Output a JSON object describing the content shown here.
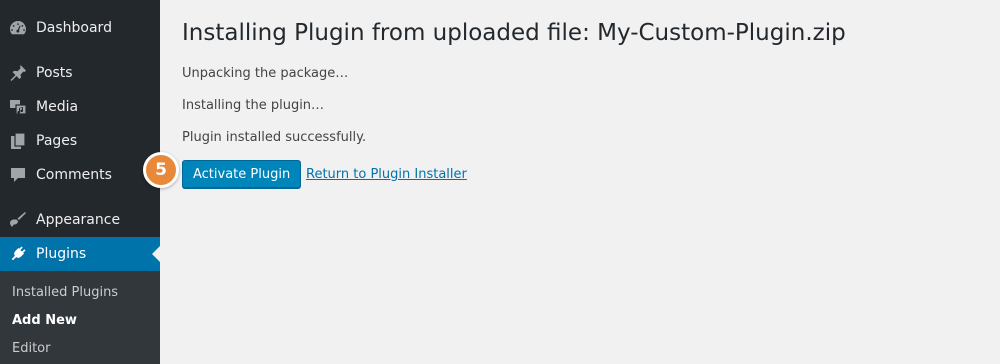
{
  "sidebar": {
    "items": [
      {
        "label": "Dashboard",
        "icon": "dashboard-icon"
      },
      {
        "label": "Posts",
        "icon": "pin-icon"
      },
      {
        "label": "Media",
        "icon": "media-icon"
      },
      {
        "label": "Pages",
        "icon": "pages-icon"
      },
      {
        "label": "Comments",
        "icon": "comment-icon"
      },
      {
        "label": "Appearance",
        "icon": "paintbrush-icon"
      },
      {
        "label": "Plugins",
        "icon": "plugin-icon",
        "active": true
      }
    ],
    "submenu": [
      {
        "label": "Installed Plugins"
      },
      {
        "label": "Add New",
        "current": true
      },
      {
        "label": "Editor"
      }
    ]
  },
  "main": {
    "title": "Installing Plugin from uploaded file: My-Custom-Plugin.zip",
    "steps": [
      "Unpacking the package…",
      "Installing the plugin…",
      "Plugin installed successfully."
    ],
    "activate_label": "Activate Plugin",
    "return_label": "Return to Plugin Installer"
  },
  "step_badge": "5",
  "colors": {
    "sidebar_bg": "#23282d",
    "submenu_bg": "#32373c",
    "accent": "#0073aa",
    "button_bg": "#0085ba",
    "badge": "#e8893a",
    "page_bg": "#f1f1f1"
  }
}
